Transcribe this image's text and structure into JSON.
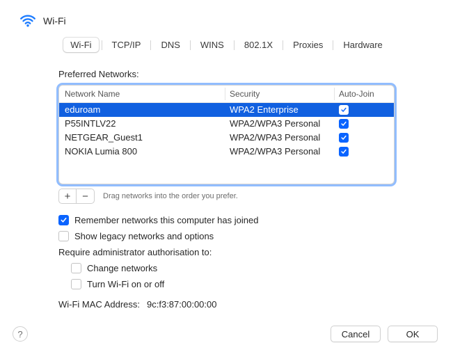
{
  "header": {
    "title": "Wi-Fi",
    "icon": "wifi-icon"
  },
  "tabs": [
    {
      "label": "Wi-Fi",
      "active": true
    },
    {
      "label": "TCP/IP",
      "active": false
    },
    {
      "label": "DNS",
      "active": false
    },
    {
      "label": "WINS",
      "active": false
    },
    {
      "label": "802.1X",
      "active": false
    },
    {
      "label": "Proxies",
      "active": false
    },
    {
      "label": "Hardware",
      "active": false
    }
  ],
  "section_label": "Preferred Networks:",
  "columns": {
    "name": "Network Name",
    "security": "Security",
    "autojoin": "Auto-Join"
  },
  "networks": [
    {
      "name": "eduroam",
      "security": "WPA2 Enterprise",
      "autojoin": true,
      "selected": true
    },
    {
      "name": "P55INTLV22",
      "security": "WPA2/WPA3 Personal",
      "autojoin": true,
      "selected": false
    },
    {
      "name": "NETGEAR_Guest1",
      "security": "WPA2/WPA3 Personal",
      "autojoin": true,
      "selected": false
    },
    {
      "name": "NOKIA Lumia 800",
      "security": "WPA2/WPA3 Personal",
      "autojoin": true,
      "selected": false
    }
  ],
  "drag_hint": "Drag networks into the order you prefer.",
  "icons": {
    "plus": "+",
    "minus": "−",
    "help": "?"
  },
  "options": {
    "remember": {
      "label": "Remember networks this computer has joined",
      "checked": true
    },
    "legacy": {
      "label": "Show legacy networks and options",
      "checked": false
    },
    "admin_intro": "Require administrator authorisation to:",
    "change_net": {
      "label": "Change networks",
      "checked": false
    },
    "wifi_toggle": {
      "label": "Turn Wi-Fi on or off",
      "checked": false
    }
  },
  "mac": {
    "label": "Wi-Fi MAC Address:",
    "value": "9c:f3:87:00:00:00"
  },
  "footer": {
    "cancel": "Cancel",
    "ok": "OK"
  }
}
